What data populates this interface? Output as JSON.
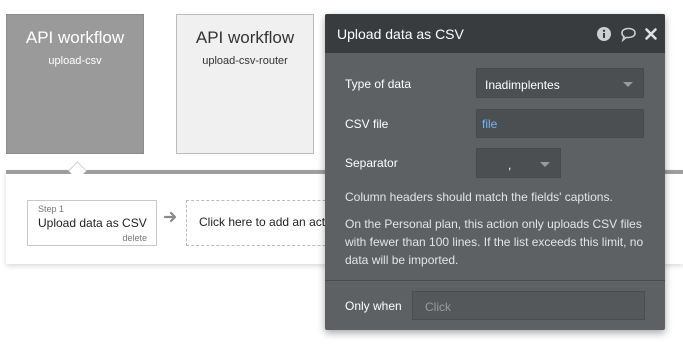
{
  "workflows": [
    {
      "title": "API workflow",
      "name": "upload-csv"
    },
    {
      "title": "API workflow",
      "name": "upload-csv-router"
    }
  ],
  "step": {
    "number": "Step 1",
    "name": "Upload data as CSV",
    "delete_label": "delete"
  },
  "add_action_label": "Click here to add an action...",
  "editor": {
    "title": "Upload data as CSV",
    "header_icons": [
      "info-icon",
      "comment-icon",
      "close-icon"
    ],
    "fields": {
      "type_of_data_label": "Type of data",
      "type_of_data_value": "Inadimplentes",
      "csv_file_label": "CSV file",
      "csv_file_value": "file",
      "separator_label": "Separator",
      "separator_value": ","
    },
    "note1": "Column headers should match the fields' captions.",
    "note2": "On the Personal plan, this action only uploads CSV files with fewer than 100 lines. If the list exceeds this limit, no data will be imported.",
    "only_when_label": "Only when",
    "only_when_placeholder": "Click"
  },
  "colors": {
    "editor_bg": "#5e6163",
    "editor_header": "#393c3e",
    "link": "#6cb8ff"
  }
}
